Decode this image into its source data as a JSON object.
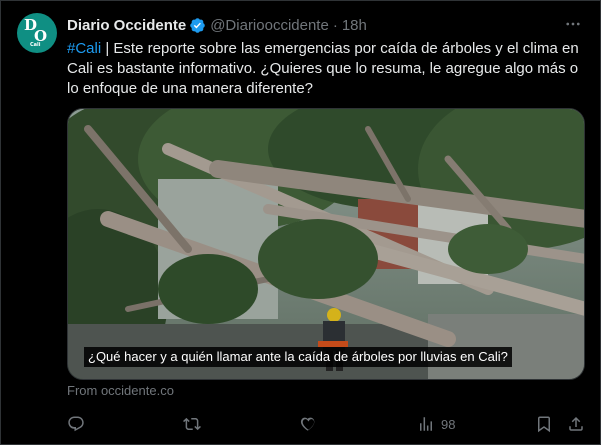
{
  "post": {
    "author_name": "Diario Occidente",
    "handle": "@Diariooccidente",
    "separator": "·",
    "time": "18h",
    "avatar_text": {
      "line1": "D",
      "line2": "O",
      "line3": "Cali"
    },
    "hashtag": "#Cali",
    "text": " | Este reporte sobre las emergencias por caída de árboles y el clima en Cali es bastante informativo. ¿Quieres que lo resuma, le agregue algo más o lo enfoque de una manera diferente?",
    "media_caption": "¿Qué hacer y a quién llamar ante la caída de árboles por lluvias en Cali?",
    "source": "From occidente.co"
  },
  "actions": {
    "reply": {
      "icon": "reply-icon"
    },
    "repost": {
      "icon": "repost-icon"
    },
    "like": {
      "icon": "like-icon"
    },
    "views": {
      "icon": "views-icon",
      "count": "98"
    },
    "bookmark": {
      "icon": "bookmark-icon"
    },
    "share": {
      "icon": "share-icon"
    }
  },
  "colors": {
    "background": "#000000",
    "text": "#e7e9ea",
    "muted": "#71767b",
    "accent": "#1d9bf0",
    "avatar": "#0f8f83"
  }
}
